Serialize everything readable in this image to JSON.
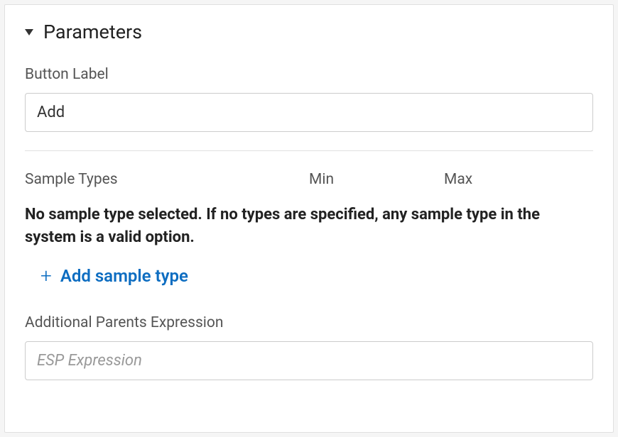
{
  "section": {
    "title": "Parameters"
  },
  "buttonLabel": {
    "label": "Button Label",
    "value": "Add"
  },
  "columns": {
    "sampleTypes": "Sample Types",
    "min": "Min",
    "max": "Max"
  },
  "emptyMessage": "No sample type selected. If no types are specified, any sample type in the system is a valid option.",
  "addSampleType": "Add sample type",
  "additionalParents": {
    "label": "Additional Parents Expression",
    "placeholder": "ESP Expression"
  }
}
